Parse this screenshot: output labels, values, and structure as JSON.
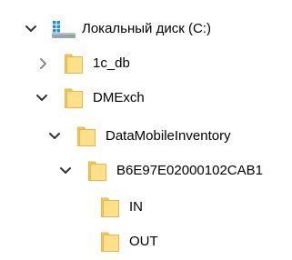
{
  "tree": {
    "nodes": [
      {
        "label": "Локальный диск (C:)",
        "expander": "chevron-down-icon",
        "icon": "drive-icon"
      },
      {
        "label": "1c_db",
        "expander": "chevron-right-icon",
        "icon": "folder-icon"
      },
      {
        "label": "DMExch",
        "expander": "chevron-down-icon",
        "icon": "folder-icon"
      },
      {
        "label": "DataMobileInventory",
        "expander": "chevron-down-icon",
        "icon": "folder-icon"
      },
      {
        "label": "B6E97E02000102CAB1",
        "expander": "chevron-down-icon",
        "icon": "folder-icon"
      },
      {
        "label": "IN",
        "expander": "",
        "icon": "folder-icon"
      },
      {
        "label": "OUT",
        "expander": "",
        "icon": "folder-icon"
      }
    ]
  },
  "colors": {
    "folder_fill": "#FFE08A",
    "folder_stroke": "#E8B84A",
    "drive_blue": "#1E90D6",
    "drive_gray": "#9AA4AE",
    "chevron_dark": "#333333",
    "chevron_light": "#8A8A8A"
  }
}
